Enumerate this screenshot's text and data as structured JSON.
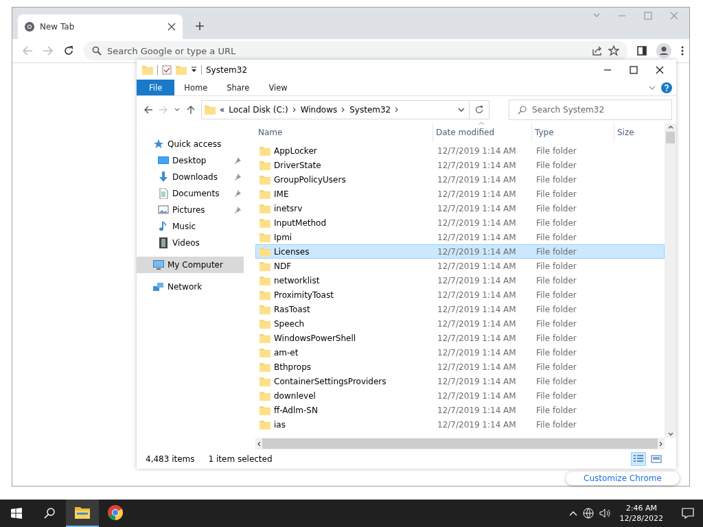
{
  "browser": {
    "tabs": [
      {
        "title": "New Tab",
        "selected": true
      }
    ],
    "address_placeholder": "Search Google or type a URL",
    "customize_button": "Customize Chrome"
  },
  "explorer": {
    "title": "System32",
    "ribbon_tabs": [
      {
        "label": "File",
        "kind": "file"
      },
      {
        "label": "Home",
        "kind": "tab"
      },
      {
        "label": "Share",
        "kind": "tab"
      },
      {
        "label": "View",
        "kind": "tab"
      }
    ],
    "breadcrumb_overflow": "«",
    "breadcrumb": [
      "Local Disk (C:)",
      "Windows",
      "System32"
    ],
    "search_placeholder": "Search System32",
    "nav": [
      {
        "label": "Quick access",
        "kind": "star",
        "selected": false,
        "children": [
          {
            "label": "Desktop",
            "kind": "desktop",
            "pinned": true,
            "selected": false
          },
          {
            "label": "Downloads",
            "kind": "download",
            "pinned": true,
            "selected": false
          },
          {
            "label": "Documents",
            "kind": "document",
            "pinned": true,
            "selected": false
          },
          {
            "label": "Pictures",
            "kind": "pictures",
            "pinned": true,
            "selected": false
          },
          {
            "label": "Music",
            "kind": "music",
            "pinned": false,
            "selected": false
          },
          {
            "label": "Videos",
            "kind": "video",
            "pinned": false,
            "selected": false
          }
        ]
      },
      {
        "label": "My Computer",
        "kind": "computer",
        "selected": true
      },
      {
        "label": "Network",
        "kind": "network",
        "selected": false
      }
    ],
    "columns": [
      {
        "label": "Name",
        "sorted": false
      },
      {
        "label": "Date modified",
        "sorted": true
      },
      {
        "label": "Type",
        "sorted": false
      },
      {
        "label": "Size",
        "sorted": false
      }
    ],
    "rows": [
      {
        "name": "AppLocker",
        "date": "12/7/2019 1:14 AM",
        "type": "File folder",
        "selected": false
      },
      {
        "name": "DriverState",
        "date": "12/7/2019 1:14 AM",
        "type": "File folder",
        "selected": false
      },
      {
        "name": "GroupPolicyUsers",
        "date": "12/7/2019 1:14 AM",
        "type": "File folder",
        "selected": false
      },
      {
        "name": "IME",
        "date": "12/7/2019 1:14 AM",
        "type": "File folder",
        "selected": false
      },
      {
        "name": "inetsrv",
        "date": "12/7/2019 1:14 AM",
        "type": "File folder",
        "selected": false
      },
      {
        "name": "InputMethod",
        "date": "12/7/2019 1:14 AM",
        "type": "File folder",
        "selected": false
      },
      {
        "name": "Ipmi",
        "date": "12/7/2019 1:14 AM",
        "type": "File folder",
        "selected": false
      },
      {
        "name": "Licenses",
        "date": "12/7/2019 1:14 AM",
        "type": "File folder",
        "selected": true
      },
      {
        "name": "NDF",
        "date": "12/7/2019 1:14 AM",
        "type": "File folder",
        "selected": false
      },
      {
        "name": "networklist",
        "date": "12/7/2019 1:14 AM",
        "type": "File folder",
        "selected": false
      },
      {
        "name": "ProximityToast",
        "date": "12/7/2019 1:14 AM",
        "type": "File folder",
        "selected": false
      },
      {
        "name": "RasToast",
        "date": "12/7/2019 1:14 AM",
        "type": "File folder",
        "selected": false
      },
      {
        "name": "Speech",
        "date": "12/7/2019 1:14 AM",
        "type": "File folder",
        "selected": false
      },
      {
        "name": "WindowsPowerShell",
        "date": "12/7/2019 1:14 AM",
        "type": "File folder",
        "selected": false
      },
      {
        "name": "am-et",
        "date": "12/7/2019 1:14 AM",
        "type": "File folder",
        "selected": false
      },
      {
        "name": "Bthprops",
        "date": "12/7/2019 1:14 AM",
        "type": "File folder",
        "selected": false
      },
      {
        "name": "ContainerSettingsProviders",
        "date": "12/7/2019 1:14 AM",
        "type": "File folder",
        "selected": false
      },
      {
        "name": "downlevel",
        "date": "12/7/2019 1:14 AM",
        "type": "File folder",
        "selected": false
      },
      {
        "name": "ff-Adlm-SN",
        "date": "12/7/2019 1:14 AM",
        "type": "File folder",
        "selected": false
      },
      {
        "name": "ias",
        "date": "12/7/2019 1:14 AM",
        "type": "File folder",
        "selected": false
      }
    ],
    "status": {
      "count": "4,483 items",
      "selection": "1 item selected"
    },
    "views": [
      {
        "kind": "details",
        "selected": true
      },
      {
        "kind": "thumbnails",
        "selected": false
      }
    ]
  },
  "taskbar": {
    "apps": [
      {
        "kind": "explorer",
        "active": true
      },
      {
        "kind": "chrome",
        "active": false
      }
    ],
    "time": "2:46 AM",
    "date": "12/28/2022"
  }
}
